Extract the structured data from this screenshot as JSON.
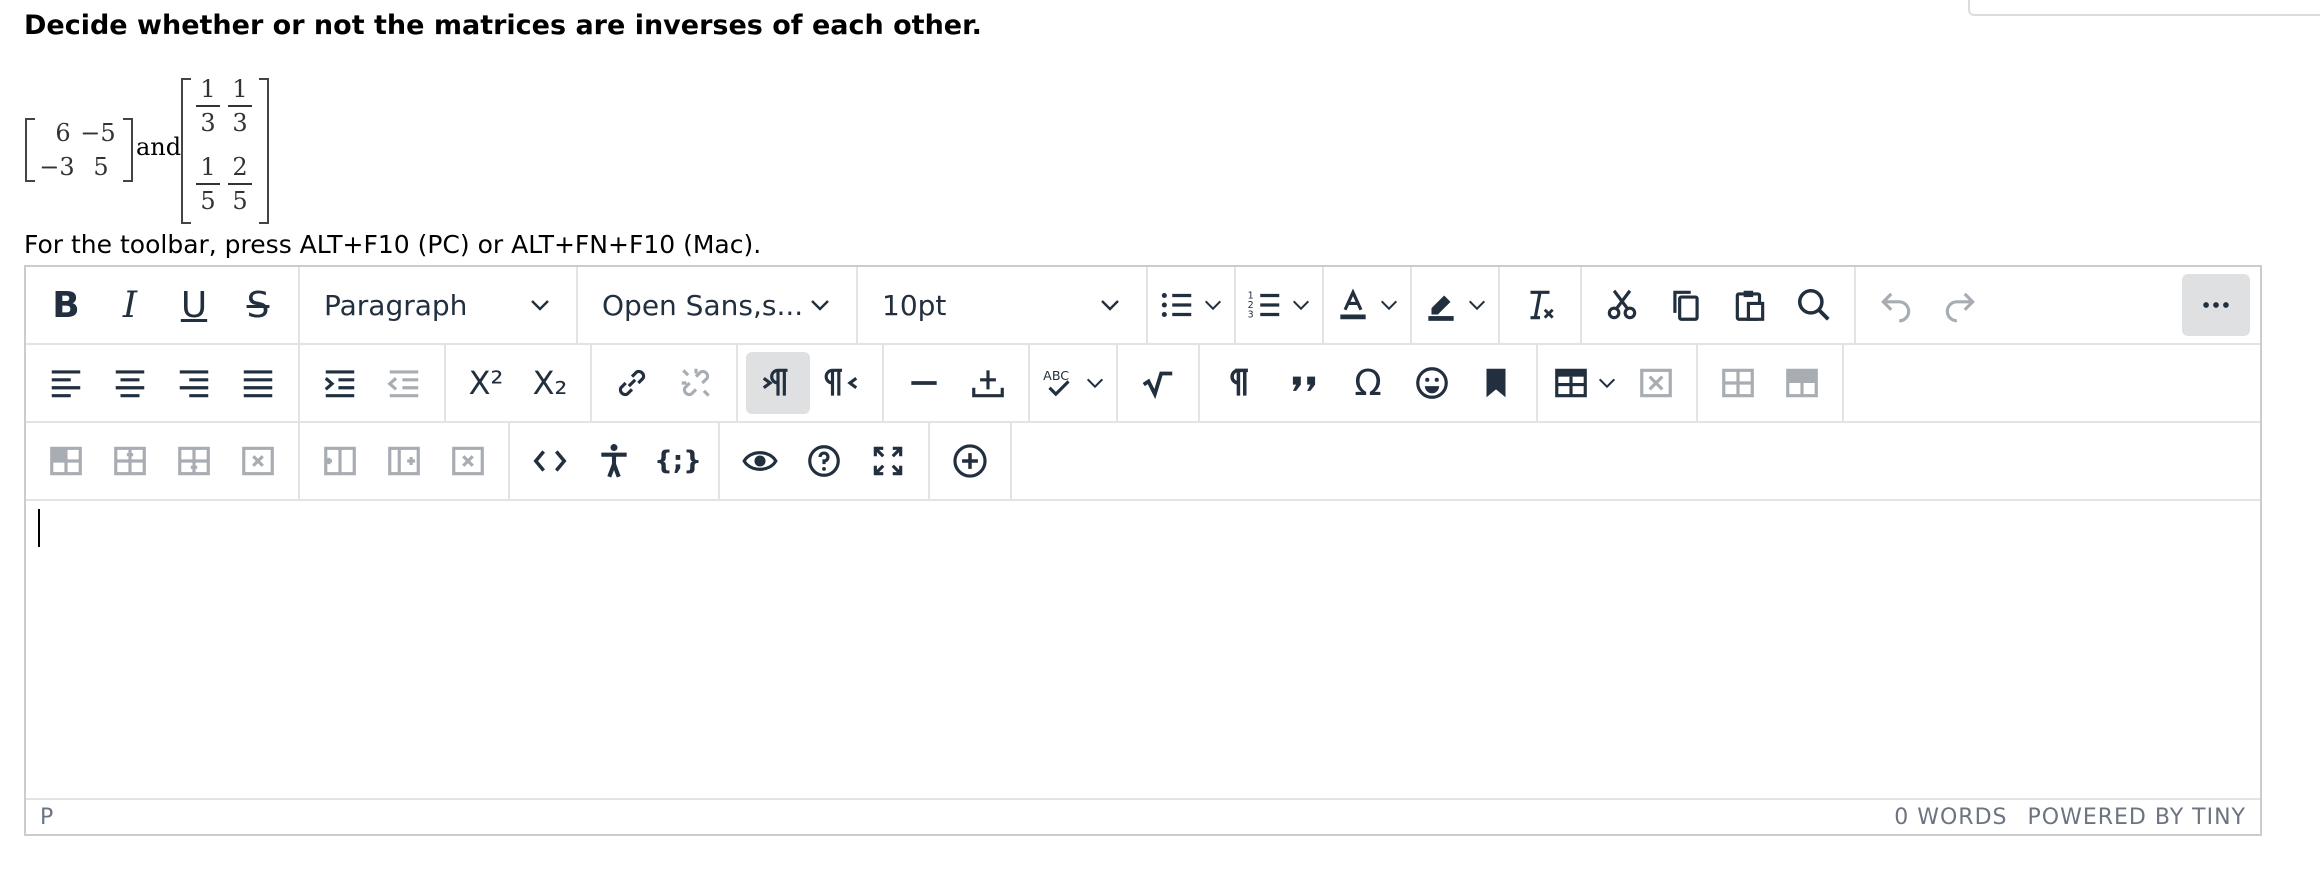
{
  "question": "Decide whether or not the matrices are inverses of each other.",
  "matrix_a": {
    "r1c1": "6",
    "r1c2": "−5",
    "r2c1": "−3",
    "r2c2": "5"
  },
  "conjunction": "and",
  "matrix_b": {
    "r1c1": {
      "num": "1",
      "den": "3"
    },
    "r1c2": {
      "num": "1",
      "den": "3"
    },
    "r2c1": {
      "num": "1",
      "den": "5"
    },
    "r2c2": {
      "num": "2",
      "den": "5"
    }
  },
  "toolbar_hint": "For the toolbar, press ALT+F10 (PC) or ALT+FN+F10 (Mac).",
  "toolbar": {
    "bold": "B",
    "italic": "I",
    "underline": "U",
    "strike": "S",
    "block_format": "Paragraph",
    "font_family": "Open Sans,s...",
    "font_size": "10pt",
    "superscript": "X²",
    "subscript": "X₂"
  },
  "icons": [
    "bold-icon",
    "italic-icon",
    "underline-icon",
    "strikethrough-icon",
    "bullet-list-icon",
    "numbered-list-icon",
    "text-color-icon",
    "highlight-icon",
    "clear-formatting-icon",
    "cut-icon",
    "copy-icon",
    "paste-icon",
    "search-icon",
    "undo-icon",
    "redo-icon",
    "more-icon",
    "align-left-icon",
    "align-center-icon",
    "align-right-icon",
    "justify-icon",
    "indent-icon",
    "outdent-icon",
    "link-icon",
    "unlink-icon",
    "ltr-icon",
    "rtl-icon",
    "horizontal-line-icon",
    "insert-anchor-icon",
    "spellcheck-icon",
    "math-icon",
    "paragraph-mark-icon",
    "quote-icon",
    "omega-icon",
    "emoji-icon",
    "bookmark-icon",
    "table-icon",
    "delete-table-icon",
    "accessibility-icon",
    "code-icon",
    "preview-icon",
    "help-icon",
    "fullscreen-icon",
    "add-icon"
  ],
  "status": {
    "path": "P",
    "word_count": "0 WORDS",
    "powered_by": "POWERED BY TINY"
  },
  "colors": {
    "active_bg": "#dee0e2",
    "icon": "#222f3e",
    "disabled": "#a8adb3",
    "border": "#cccccc"
  }
}
